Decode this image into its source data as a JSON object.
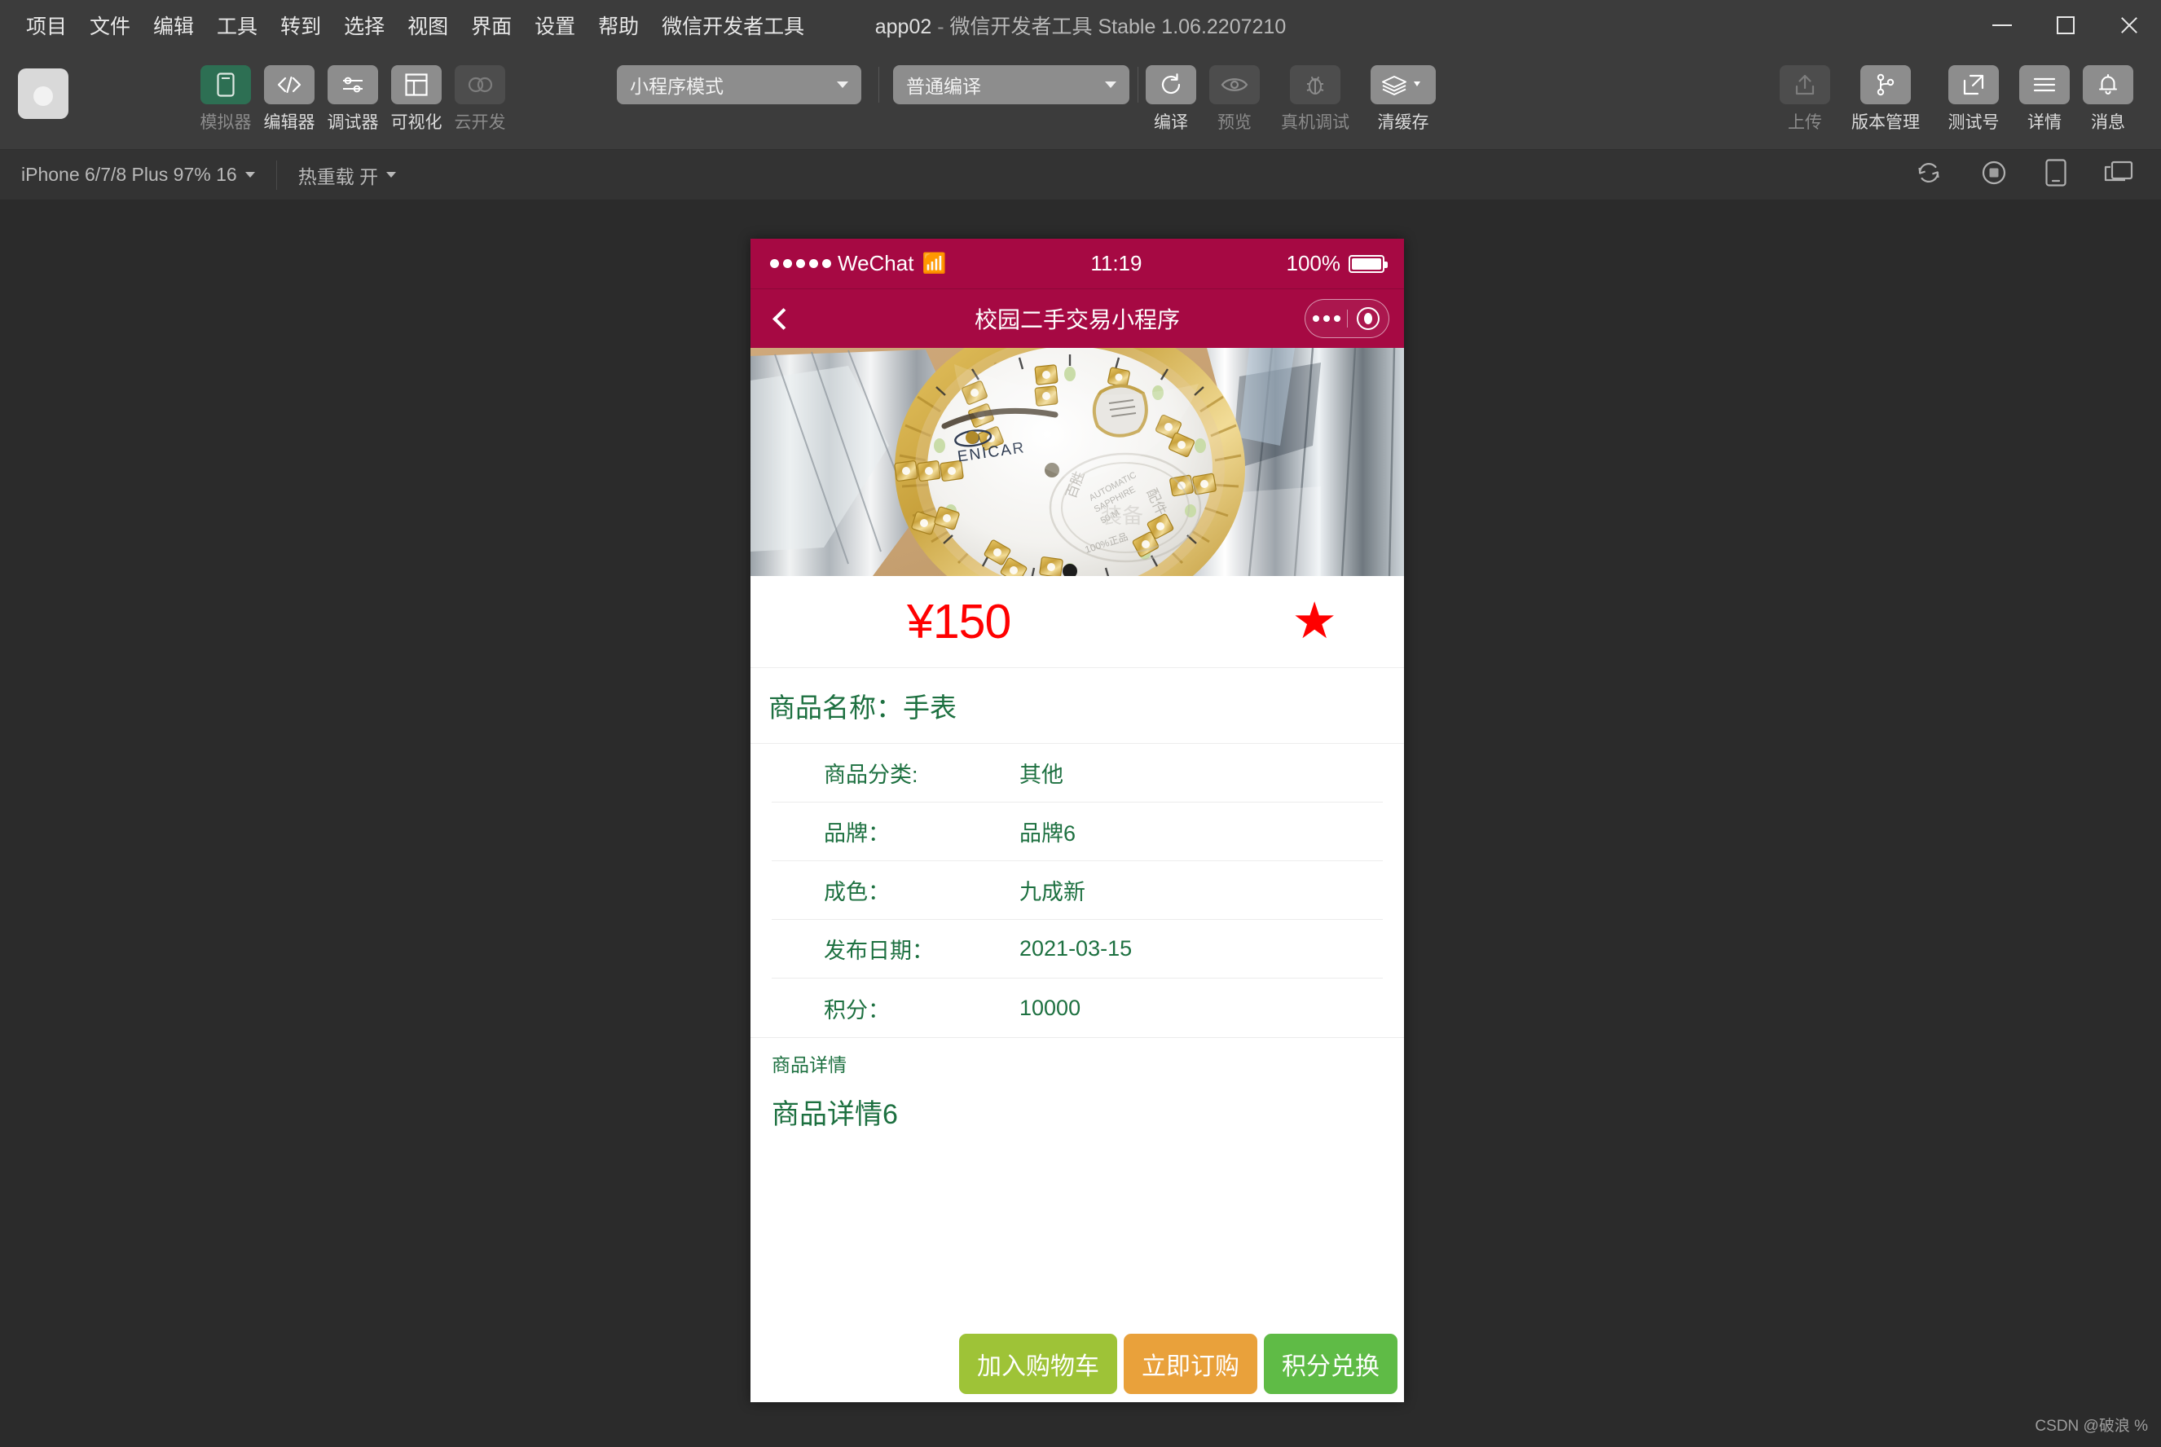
{
  "window": {
    "title_app": "app02",
    "title_dash": "-",
    "title_rest": "微信开发者工具 Stable 1.06.2207210",
    "minimize_label": "最小化",
    "maximize_label": "最大化",
    "close_label": "关闭"
  },
  "menubar": {
    "items": [
      {
        "label": "项目"
      },
      {
        "label": "文件"
      },
      {
        "label": "编辑"
      },
      {
        "label": "工具"
      },
      {
        "label": "转到"
      },
      {
        "label": "选择"
      },
      {
        "label": "视图"
      },
      {
        "label": "界面"
      },
      {
        "label": "设置"
      },
      {
        "label": "帮助"
      },
      {
        "label": "微信开发者工具"
      }
    ]
  },
  "toolbar": {
    "panels": [
      {
        "label": "模拟器",
        "icon": "phone-icon",
        "state": "active",
        "dim_label": true
      },
      {
        "label": "编辑器",
        "icon": "code-icon",
        "state": "normal",
        "dim_label": false
      },
      {
        "label": "调试器",
        "icon": "sliders-icon",
        "state": "normal",
        "dim_label": false
      },
      {
        "label": "可视化",
        "icon": "layout-icon",
        "state": "normal",
        "dim_label": false
      },
      {
        "label": "云开发",
        "icon": "cloud-icon",
        "state": "disabled",
        "dim_label": true
      }
    ],
    "mode_select": "小程序模式",
    "compile_select": "普通编译",
    "actions": [
      {
        "label": "编译",
        "icon": "refresh-icon",
        "dim": false
      },
      {
        "label": "预览",
        "icon": "eye-icon",
        "dim": true
      },
      {
        "label": "真机调试",
        "icon": "bug-icon",
        "dim": true
      },
      {
        "label": "清缓存",
        "icon": "layers-icon",
        "dim": false
      }
    ],
    "right_actions": [
      {
        "label": "上传",
        "icon": "upload-icon",
        "dim": true
      },
      {
        "label": "版本管理",
        "icon": "git-branch-icon",
        "dim": false
      },
      {
        "label": "测试号",
        "icon": "external-link-icon",
        "dim": false
      },
      {
        "label": "详情",
        "icon": "menu-icon",
        "dim": false
      },
      {
        "label": "消息",
        "icon": "bell-icon",
        "dim": false
      }
    ]
  },
  "devicebar": {
    "device": "iPhone 6/7/8 Plus 97% 16",
    "hotreload": "热重载 开",
    "right_icons": [
      {
        "name": "refresh-simulator-icon"
      },
      {
        "name": "record-icon"
      },
      {
        "name": "device-icon"
      },
      {
        "name": "detach-window-icon"
      }
    ]
  },
  "simulator": {
    "statusbar": {
      "carrier": "WeChat",
      "time": "11:19",
      "battery": "100%"
    },
    "navbar": {
      "title": "校园二手交易小程序",
      "back_label": "返回"
    },
    "product": {
      "image_alt": "ENICAR 手表 商品图片",
      "price": "¥150",
      "favorite_icon": "star-filled-icon",
      "name_label": "商品名称：手表",
      "specs": [
        {
          "key": "商品分类:",
          "value": "其他"
        },
        {
          "key": "品牌：",
          "value": "品牌6"
        },
        {
          "key": "成色：",
          "value": "九成新"
        },
        {
          "key": "发布日期：",
          "value": "2021-03-15"
        },
        {
          "key": "积分：",
          "value": "10000"
        }
      ],
      "detail_label": "商品详情",
      "detail_text": "商品详情6",
      "buttons": [
        {
          "label": "加入购物车",
          "color": "#9ec337"
        },
        {
          "label": "立即订购",
          "color": "#e9a13b"
        },
        {
          "label": "积分兑换",
          "color": "#5fbb46"
        }
      ]
    }
  },
  "watermark": "CSDN @破浪 %",
  "colors": {
    "wechat_red": "#a60943",
    "price_red": "#ff0000",
    "green_text": "#1d7040",
    "accent_green": "#2d6f53"
  }
}
